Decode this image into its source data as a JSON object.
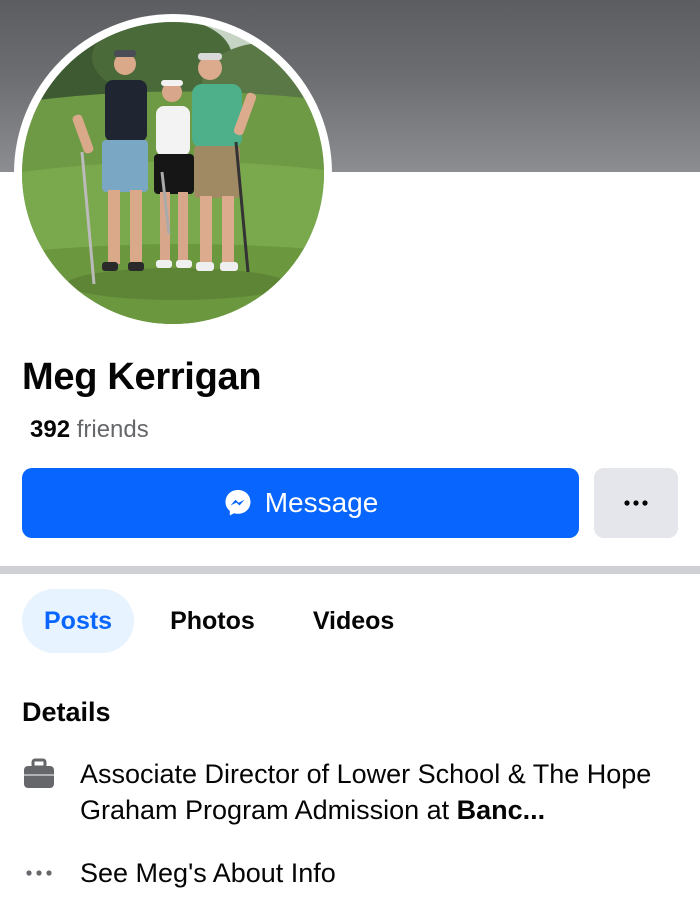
{
  "profile": {
    "name": "Meg Kerrigan",
    "friends_count": "392",
    "friends_label": "friends"
  },
  "actions": {
    "message_label": "Message",
    "more_label": "..."
  },
  "tabs": [
    {
      "label": "Posts",
      "active": true
    },
    {
      "label": "Photos",
      "active": false
    },
    {
      "label": "Videos",
      "active": false
    }
  ],
  "details": {
    "title": "Details",
    "work_text": "Associate Director of Lower School & The Hope Graham Program Admission at ",
    "work_bold": "Banc...",
    "see_about": "See Meg's About Info"
  },
  "colors": {
    "accent": "#0866ff",
    "tab_active_bg": "#e7f3ff",
    "secondary_button": "#e4e6eb",
    "divider": "#ced0d4"
  },
  "icons": {
    "message": "messenger-icon",
    "more": "more-dots-icon",
    "work": "briefcase-icon",
    "about": "ellipsis-icon"
  }
}
